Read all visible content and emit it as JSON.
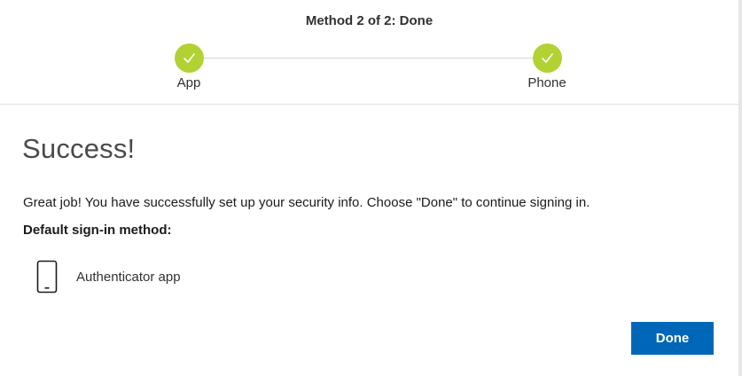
{
  "header": {
    "title": "Method 2 of 2: Done"
  },
  "steps": [
    {
      "label": "App",
      "status": "complete",
      "icon": "checkmark-icon"
    },
    {
      "label": "Phone",
      "status": "complete",
      "icon": "checkmark-icon"
    }
  ],
  "main": {
    "title": "Success!",
    "message": "Great job! You have successfully set up your security info. Choose \"Done\" to continue signing in.",
    "default_method_label": "Default sign-in method:",
    "default_method": {
      "icon": "phone-icon",
      "label": "Authenticator app"
    },
    "done_button": "Done"
  },
  "colors": {
    "step_complete": "#b2d233",
    "primary_button": "#0067b8",
    "button_text": "#ffffff"
  }
}
